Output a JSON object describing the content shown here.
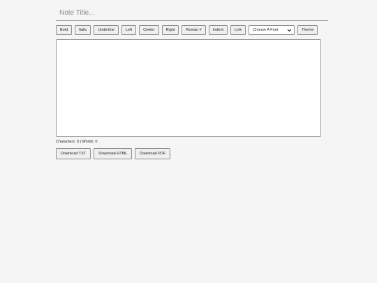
{
  "title_field": {
    "placeholder": "Note Title...",
    "value": ""
  },
  "toolbar": {
    "bold": "Bold",
    "italic": "Italic",
    "underline": "Underline",
    "left": "Left",
    "center": "Center",
    "right": "Right",
    "roman": "Roman #",
    "indent": "Indent",
    "link": "Link",
    "font_select": {
      "selected": "Choose A Font",
      "icon": "chevron-down-icon"
    },
    "theme": "Theme"
  },
  "editor": {
    "content": ""
  },
  "stats": {
    "characters_label": "Characters:",
    "characters_value": "0",
    "separator": "|",
    "words_label": "Words:",
    "words_value": "0"
  },
  "downloads": {
    "txt": "Download TXT",
    "html": "Download HTML",
    "pdf": "Download PDF"
  }
}
